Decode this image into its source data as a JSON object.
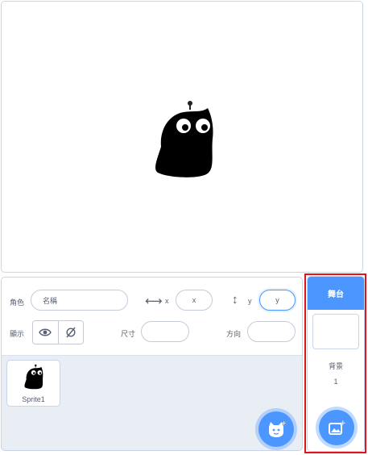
{
  "sprite_info": {
    "sprite_label": "角色",
    "name_placeholder": "名稱",
    "x_label": "x",
    "x_placeholder": "x",
    "y_label": "y",
    "y_placeholder": "y",
    "show_label": "顯示",
    "size_label": "尺寸",
    "direction_label": "方向"
  },
  "sprites": [
    {
      "name": "Sprite1"
    }
  ],
  "stage_panel": {
    "title": "舞台",
    "backdrops_label": "背景",
    "backdrops_count": "1"
  },
  "colors": {
    "accent": "#4c97ff",
    "highlight_border": "#e0141e",
    "panel_bg": "#e9eef5"
  },
  "icons": [
    "cat-sprite-icon",
    "horizontal-arrows-icon",
    "vertical-arrows-icon",
    "eye-icon",
    "eye-slash-icon",
    "choose-sprite-icon",
    "choose-backdrop-icon"
  ]
}
